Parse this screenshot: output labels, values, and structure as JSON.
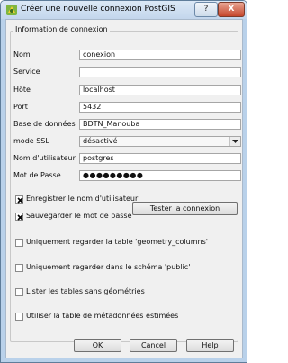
{
  "window": {
    "title": "Créer une nouvelle connexion PostGIS",
    "help_button": "?",
    "close_button": "X"
  },
  "group": {
    "title": "Information de connexion"
  },
  "fields": {
    "nom": {
      "label": "Nom",
      "value": "conexion"
    },
    "service": {
      "label": "Service",
      "value": ""
    },
    "hote": {
      "label": "Hôte",
      "value": "localhost"
    },
    "port": {
      "label": "Port",
      "value": "5432"
    },
    "database": {
      "label": "Base de données",
      "value": "BDTN_Manouba"
    },
    "ssl": {
      "label": "mode SSL",
      "value": "désactivé"
    },
    "user": {
      "label": "Nom d'utilisateur",
      "value": "postgres"
    },
    "password": {
      "label": "Mot de Passe",
      "value": "●●●●●●●●●"
    }
  },
  "checkboxes": {
    "save_user": {
      "label": "Enregistrer le nom d'utilisateur",
      "checked": true
    },
    "save_password": {
      "label": "Sauvegarder le mot de passe",
      "checked": true
    },
    "geometry_columns": {
      "label": "Uniquement regarder la table 'geometry_columns'",
      "checked": false
    },
    "public_schema": {
      "label": "Uniquement regarder dans le schéma 'public'",
      "checked": false
    },
    "no_geometry": {
      "label": "Lister les tables sans géométries",
      "checked": false
    },
    "estimated_metadata": {
      "label": "Utiliser la table de métadonnées estimées",
      "checked": false
    }
  },
  "buttons": {
    "test": "Tester la connexion",
    "ok": "OK",
    "cancel": "Cancel",
    "help": "Help"
  }
}
